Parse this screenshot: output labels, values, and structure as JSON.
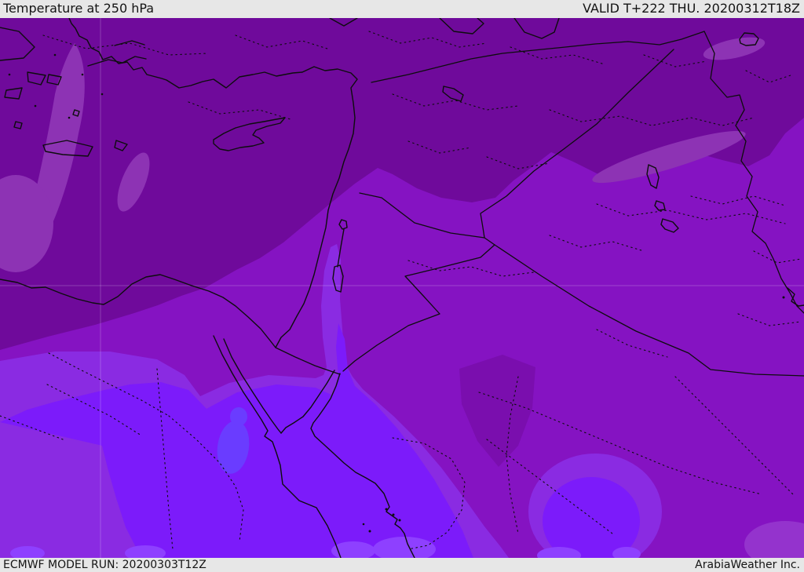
{
  "header": {
    "title": "Temperature at 250 hPa",
    "valid_label": "VALID T+222 THU. 20200312T18Z"
  },
  "footer": {
    "model_run_label": "ECMWF MODEL RUN: 20200303T12Z",
    "brand_label": "ArabiaWeather Inc."
  },
  "colors": {
    "bar_bg": "#e7e7e7",
    "bar_text": "#141414",
    "band_dark": "#6f0a9b",
    "band_dark_light": "#8d33b4",
    "band_mid": "#8513c2",
    "band_mid_light": "#9a3fd0",
    "band_mid_dark": "#7a0eae",
    "band_violet": "#8a2be2",
    "band_bright": "#7c1bfa",
    "band_bright_light": "#8e40ff",
    "band_blue": "#6a3cff",
    "coastline": "#0d0d0d",
    "graticule": "rgba(255,255,255,0.22)"
  }
}
